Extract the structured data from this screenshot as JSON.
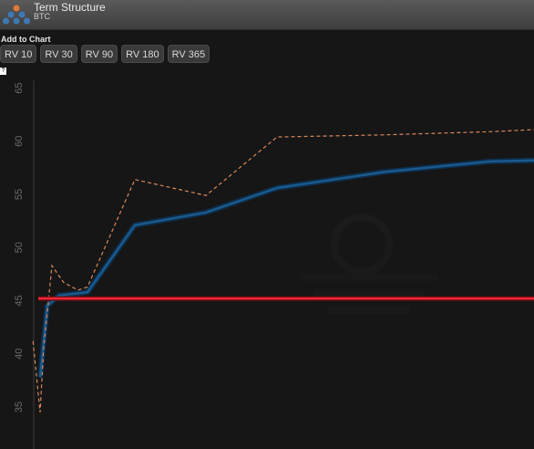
{
  "header": {
    "title": "Term Structure",
    "subtitle": "BTC",
    "logo_icon": "stacked-pyramid-logo-icon"
  },
  "add_to_chart": {
    "label": "Add to Chart",
    "buttons": [
      "RV 10",
      "RV 30",
      "RV 90",
      "RV 180",
      "RV 365"
    ]
  },
  "help_icon": "?",
  "chart_data": {
    "type": "line",
    "ylim": [
      32,
      66
    ],
    "yticks": [
      35,
      40,
      45,
      50,
      55,
      60,
      65
    ],
    "series": [
      {
        "style": "solid",
        "color": "#1a5a8e",
        "points": [
          [
            0,
            37.8
          ],
          [
            0.03,
            44.5
          ],
          [
            0.08,
            45.5
          ],
          [
            0.2,
            45.8
          ],
          [
            0.4,
            52.1
          ],
          [
            0.7,
            53.3
          ],
          [
            1.0,
            55.6
          ],
          [
            1.45,
            57.1
          ],
          [
            1.9,
            58.1
          ],
          [
            2.1,
            58.2
          ]
        ]
      },
      {
        "style": "dashed",
        "color": "#d9885c",
        "points": [
          [
            -0.03,
            41.2
          ],
          [
            0,
            34.5
          ],
          [
            0.015,
            40.5
          ],
          [
            0.05,
            48.3
          ],
          [
            0.1,
            46.7
          ],
          [
            0.16,
            46.0
          ],
          [
            0.2,
            46.3
          ],
          [
            0.4,
            56.4
          ],
          [
            0.7,
            54.9
          ],
          [
            1.0,
            60.4
          ],
          [
            1.45,
            60.6
          ],
          [
            1.9,
            60.9
          ],
          [
            2.1,
            61.1
          ]
        ]
      }
    ],
    "reference_line": {
      "value": 45.2,
      "color": "#ff2b3a"
    }
  }
}
